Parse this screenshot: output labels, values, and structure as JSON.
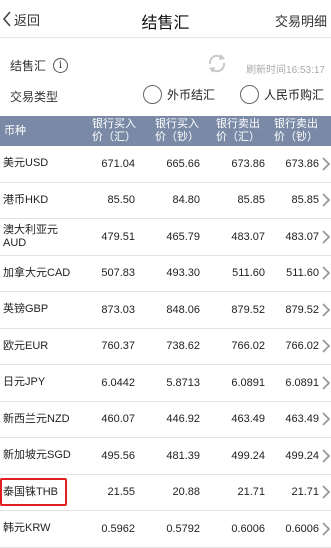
{
  "nav": {
    "back_label": "返回",
    "title": "结售汇",
    "right_label": "交易明细"
  },
  "info": {
    "label": "结售汇",
    "info_icon": "i",
    "refresh_time": "刷新时间16:53:17",
    "trade_type_label": "交易类型",
    "option_sell": "外币结汇",
    "option_buy": "人民币购汇"
  },
  "table": {
    "headers": [
      "币种",
      "银行买入价（汇）",
      "银行买入价（钞）",
      "银行卖出价（汇）",
      "银行卖出价（钞）"
    ],
    "header_lines": [
      [
        "币种"
      ],
      [
        "银行买入",
        "价（汇）"
      ],
      [
        "银行买入",
        "价（钞）"
      ],
      [
        "银行卖出",
        "价（汇）"
      ],
      [
        "银行卖出",
        "价（钞）"
      ]
    ],
    "rows": [
      {
        "name": "美元USD",
        "v1": "671.04",
        "v2": "665.66",
        "v3": "673.86",
        "v4": "673.86"
      },
      {
        "name": "港币HKD",
        "v1": "85.50",
        "v2": "84.80",
        "v3": "85.85",
        "v4": "85.85"
      },
      {
        "name": "澳大利亚元AUD",
        "v1": "479.51",
        "v2": "465.79",
        "v3": "483.07",
        "v4": "483.07"
      },
      {
        "name": "加拿大元CAD",
        "v1": "507.83",
        "v2": "493.30",
        "v3": "511.60",
        "v4": "511.60"
      },
      {
        "name": "英镑GBP",
        "v1": "873.03",
        "v2": "848.06",
        "v3": "879.52",
        "v4": "879.52"
      },
      {
        "name": "欧元EUR",
        "v1": "760.37",
        "v2": "738.62",
        "v3": "766.02",
        "v4": "766.02"
      },
      {
        "name": "日元JPY",
        "v1": "6.0442",
        "v2": "5.8713",
        "v3": "6.0891",
        "v4": "6.0891"
      },
      {
        "name": "新西兰元NZD",
        "v1": "460.07",
        "v2": "446.92",
        "v3": "463.49",
        "v4": "463.49"
      },
      {
        "name": "新加坡元SGD",
        "v1": "495.56",
        "v2": "481.39",
        "v3": "499.24",
        "v4": "499.24"
      },
      {
        "name": "泰国铢THB",
        "v1": "21.55",
        "v2": "20.88",
        "v3": "21.71",
        "v4": "21.71",
        "highlighted": true
      },
      {
        "name": "韩元KRW",
        "v1": "0.5962",
        "v2": "0.5792",
        "v3": "0.6006",
        "v4": "0.6006"
      }
    ]
  },
  "colors": {
    "header_bg": "#7a8aa6",
    "highlight_border": "#e02020"
  },
  "icons": {
    "back": "chevron-left-icon",
    "info": "info-icon",
    "refresh": "refresh-icon",
    "row": "chevron-right-icon"
  }
}
